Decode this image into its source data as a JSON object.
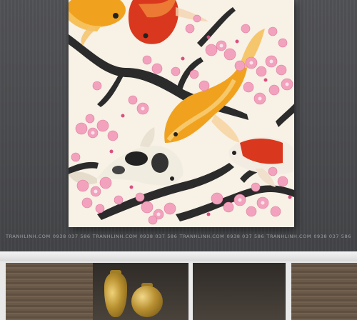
{
  "scene": {
    "artwork": "koi-fish-cherry-blossom-painting",
    "watermark_text": [
      "TRANHLINH.COM",
      "0938 037 586",
      "TRANHLINH.COM",
      "0938 037 586",
      "TRANHLINH.COM",
      "0938 037 586",
      "TRANHLINH.COM",
      "0938 037 586"
    ]
  },
  "colors": {
    "wall": "#4a4b4e",
    "canvas": "#f7f1e6",
    "branch": "#2b2b2b",
    "blossom": "#f2a2bd",
    "koi_orange": "#f0a21f",
    "koi_red": "#d9381e",
    "wood": "#6a5948",
    "gold": "#c49a35"
  }
}
